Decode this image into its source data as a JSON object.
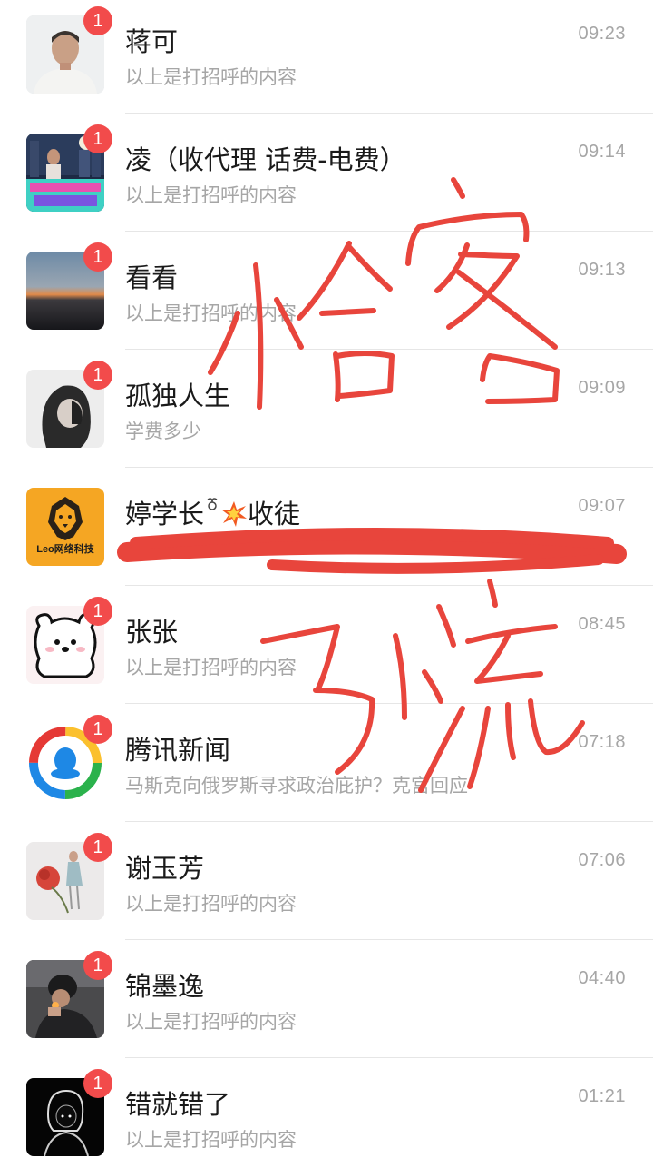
{
  "chats": [
    {
      "name": "蒋可",
      "preview": "以上是打招呼的内容",
      "time": "09:23",
      "badge": "1",
      "avatar_icon": "man-portrait-avatar"
    },
    {
      "name": "凌（收代理 话费-电费）",
      "preview": "以上是打招呼的内容",
      "time": "09:14",
      "badge": "1",
      "avatar_icon": "city-night-poster-avatar"
    },
    {
      "name": "看看",
      "preview": "以上是打招呼的内容",
      "time": "09:13",
      "badge": "1",
      "avatar_icon": "sunset-sky-avatar"
    },
    {
      "name": "孤独人生",
      "preview": "学费多少",
      "time": "09:09",
      "badge": "1",
      "avatar_icon": "girl-portrait-avatar"
    },
    {
      "name": "婷学长",
      "name_suffix": "收徒",
      "preview": "",
      "time": "09:07",
      "badge": "",
      "avatar_icon": "lion-logo-avatar",
      "avatar_text": "Leo网络科技"
    },
    {
      "name": "张张",
      "preview": "以上是打招呼的内容",
      "time": "08:45",
      "badge": "1",
      "avatar_icon": "cartoon-bear-avatar"
    },
    {
      "name": "腾讯新闻",
      "preview": "马斯克向俄罗斯寻求政治庇护？克宫回应",
      "time": "07:18",
      "badge": "1",
      "avatar_icon": "tencent-news-logo-avatar"
    },
    {
      "name": "谢玉芳",
      "preview": "以上是打招呼的内容",
      "time": "07:06",
      "badge": "1",
      "avatar_icon": "flower-girl-avatar"
    },
    {
      "name": "锦墨逸",
      "preview": "以上是打招呼的内容",
      "time": "04:40",
      "badge": "1",
      "avatar_icon": "man-smoking-avatar"
    },
    {
      "name": "错就错了",
      "preview": "以上是打招呼的内容",
      "time": "01:21",
      "badge": "1",
      "avatar_icon": "dark-hoodie-avatar"
    }
  ],
  "annotation": {
    "color": "#e8453c"
  }
}
